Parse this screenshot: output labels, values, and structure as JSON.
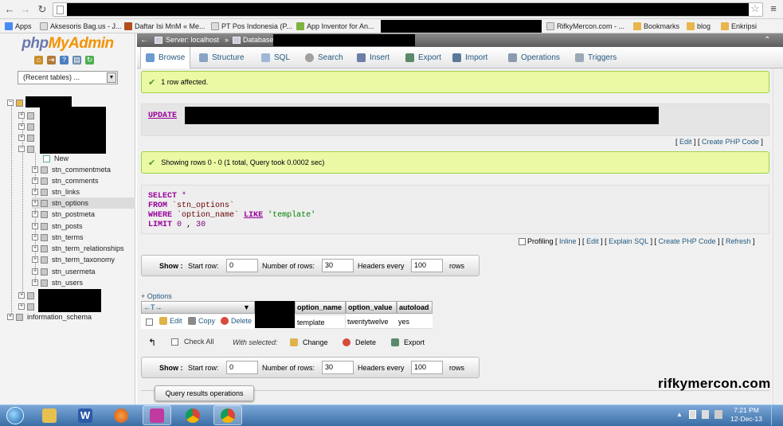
{
  "browser": {
    "bookmarks": [
      {
        "label": "Apps",
        "color": "#4a8af4"
      },
      {
        "label": "Aksesoris Bag.us - J...",
        "color": "#cccccc"
      },
      {
        "label": "Daftar Isi MnM « Me...",
        "color": "#b34d1a"
      },
      {
        "label": "PT Pos Indonesia (P...",
        "color": "#cccccc"
      },
      {
        "label": "App Inventor for An...",
        "color": "#7db43b"
      },
      {
        "label": "RifkyMercon.com - ...",
        "color": "#cccccc"
      },
      {
        "label": "Bookmarks",
        "color": "#e8b64a"
      },
      {
        "label": "blog",
        "color": "#e8b64a"
      },
      {
        "label": "Enkripsi",
        "color": "#e8b64a"
      }
    ]
  },
  "sidebar": {
    "logo_php": "php",
    "logo_myadmin": "MyAdmin",
    "recent_tables": "(Recent tables) ...",
    "new_label": "New",
    "tables": [
      "stn_commentmeta",
      "stn_comments",
      "stn_links",
      "stn_options",
      "stn_postmeta",
      "stn_posts",
      "stn_terms",
      "stn_term_relationships",
      "stn_term_taxonomy",
      "stn_usermeta",
      "stn_users"
    ],
    "selected_table": "stn_options",
    "info_schema": "information_schema"
  },
  "breadcrumb": {
    "server": "Server: localhost",
    "sep": "»",
    "database": "Database"
  },
  "tabs": [
    {
      "label": "Browse",
      "icon": "browse-icon",
      "color": "#6b9bd1"
    },
    {
      "label": "Structure",
      "icon": "structure-icon",
      "color": "#8aa4c6"
    },
    {
      "label": "SQL",
      "icon": "sql-icon",
      "color": "#9fb6d6"
    },
    {
      "label": "Search",
      "icon": "search-icon",
      "color": "#a0a0a0"
    },
    {
      "label": "Insert",
      "icon": "insert-icon",
      "color": "#6b7fa6"
    },
    {
      "label": "Export",
      "icon": "export-icon",
      "color": "#5a8a6a"
    },
    {
      "label": "Import",
      "icon": "import-icon",
      "color": "#5a7a9a"
    },
    {
      "label": "Operations",
      "icon": "operations-icon",
      "color": "#8a9ab0"
    },
    {
      "label": "Triggers",
      "icon": "triggers-icon",
      "color": "#9aa8b8"
    }
  ],
  "messages": {
    "affected": "1 row affected.",
    "showing": "Showing rows 0 - 0 (1 total, Query took 0.0002 sec)"
  },
  "update_query": {
    "keyword": "UPDATE"
  },
  "update_links": {
    "edit": "Edit",
    "create_php": "Create PHP Code"
  },
  "select_query": {
    "select_kw": "SELECT",
    "select_rest": "*",
    "from_kw": "FROM",
    "from_rest": "`stn_options`",
    "where_kw": "WHERE",
    "where_col": "`option_name`",
    "like_kw": "LIKE",
    "where_val": "'template'",
    "limit_kw": "LIMIT",
    "limit_a": "0",
    "limit_sep": ",",
    "limit_b": "30"
  },
  "select_links": {
    "profiling": "Profiling",
    "inline": "Inline",
    "edit": "Edit",
    "explain": "Explain SQL",
    "create_php": "Create PHP Code",
    "refresh": "Refresh"
  },
  "nav": {
    "show_label": "Show :",
    "start_row_label": "Start row:",
    "start_row": "0",
    "num_rows_label": "Number of rows:",
    "num_rows": "30",
    "headers_label": "Headers every",
    "headers_every": "100",
    "rows_label": "rows"
  },
  "results": {
    "options_link": "+ Options",
    "arrows": "←T→",
    "columns": [
      "option_name",
      "option_value",
      "autoload"
    ],
    "row": {
      "option_name": "template",
      "option_value": "twentytwelve",
      "autoload": "yes"
    },
    "edit": "Edit",
    "copy": "Copy",
    "delete": "Delete"
  },
  "bulk": {
    "check_all": "Check All",
    "with_selected": "With selected:",
    "change": "Change",
    "delete": "Delete",
    "export": "Export"
  },
  "query_results_operations": "Query results operations",
  "watermark": "rifkymercon.com",
  "taskbar": {
    "time": "7:21 PM",
    "date": "12-Dec-13"
  }
}
